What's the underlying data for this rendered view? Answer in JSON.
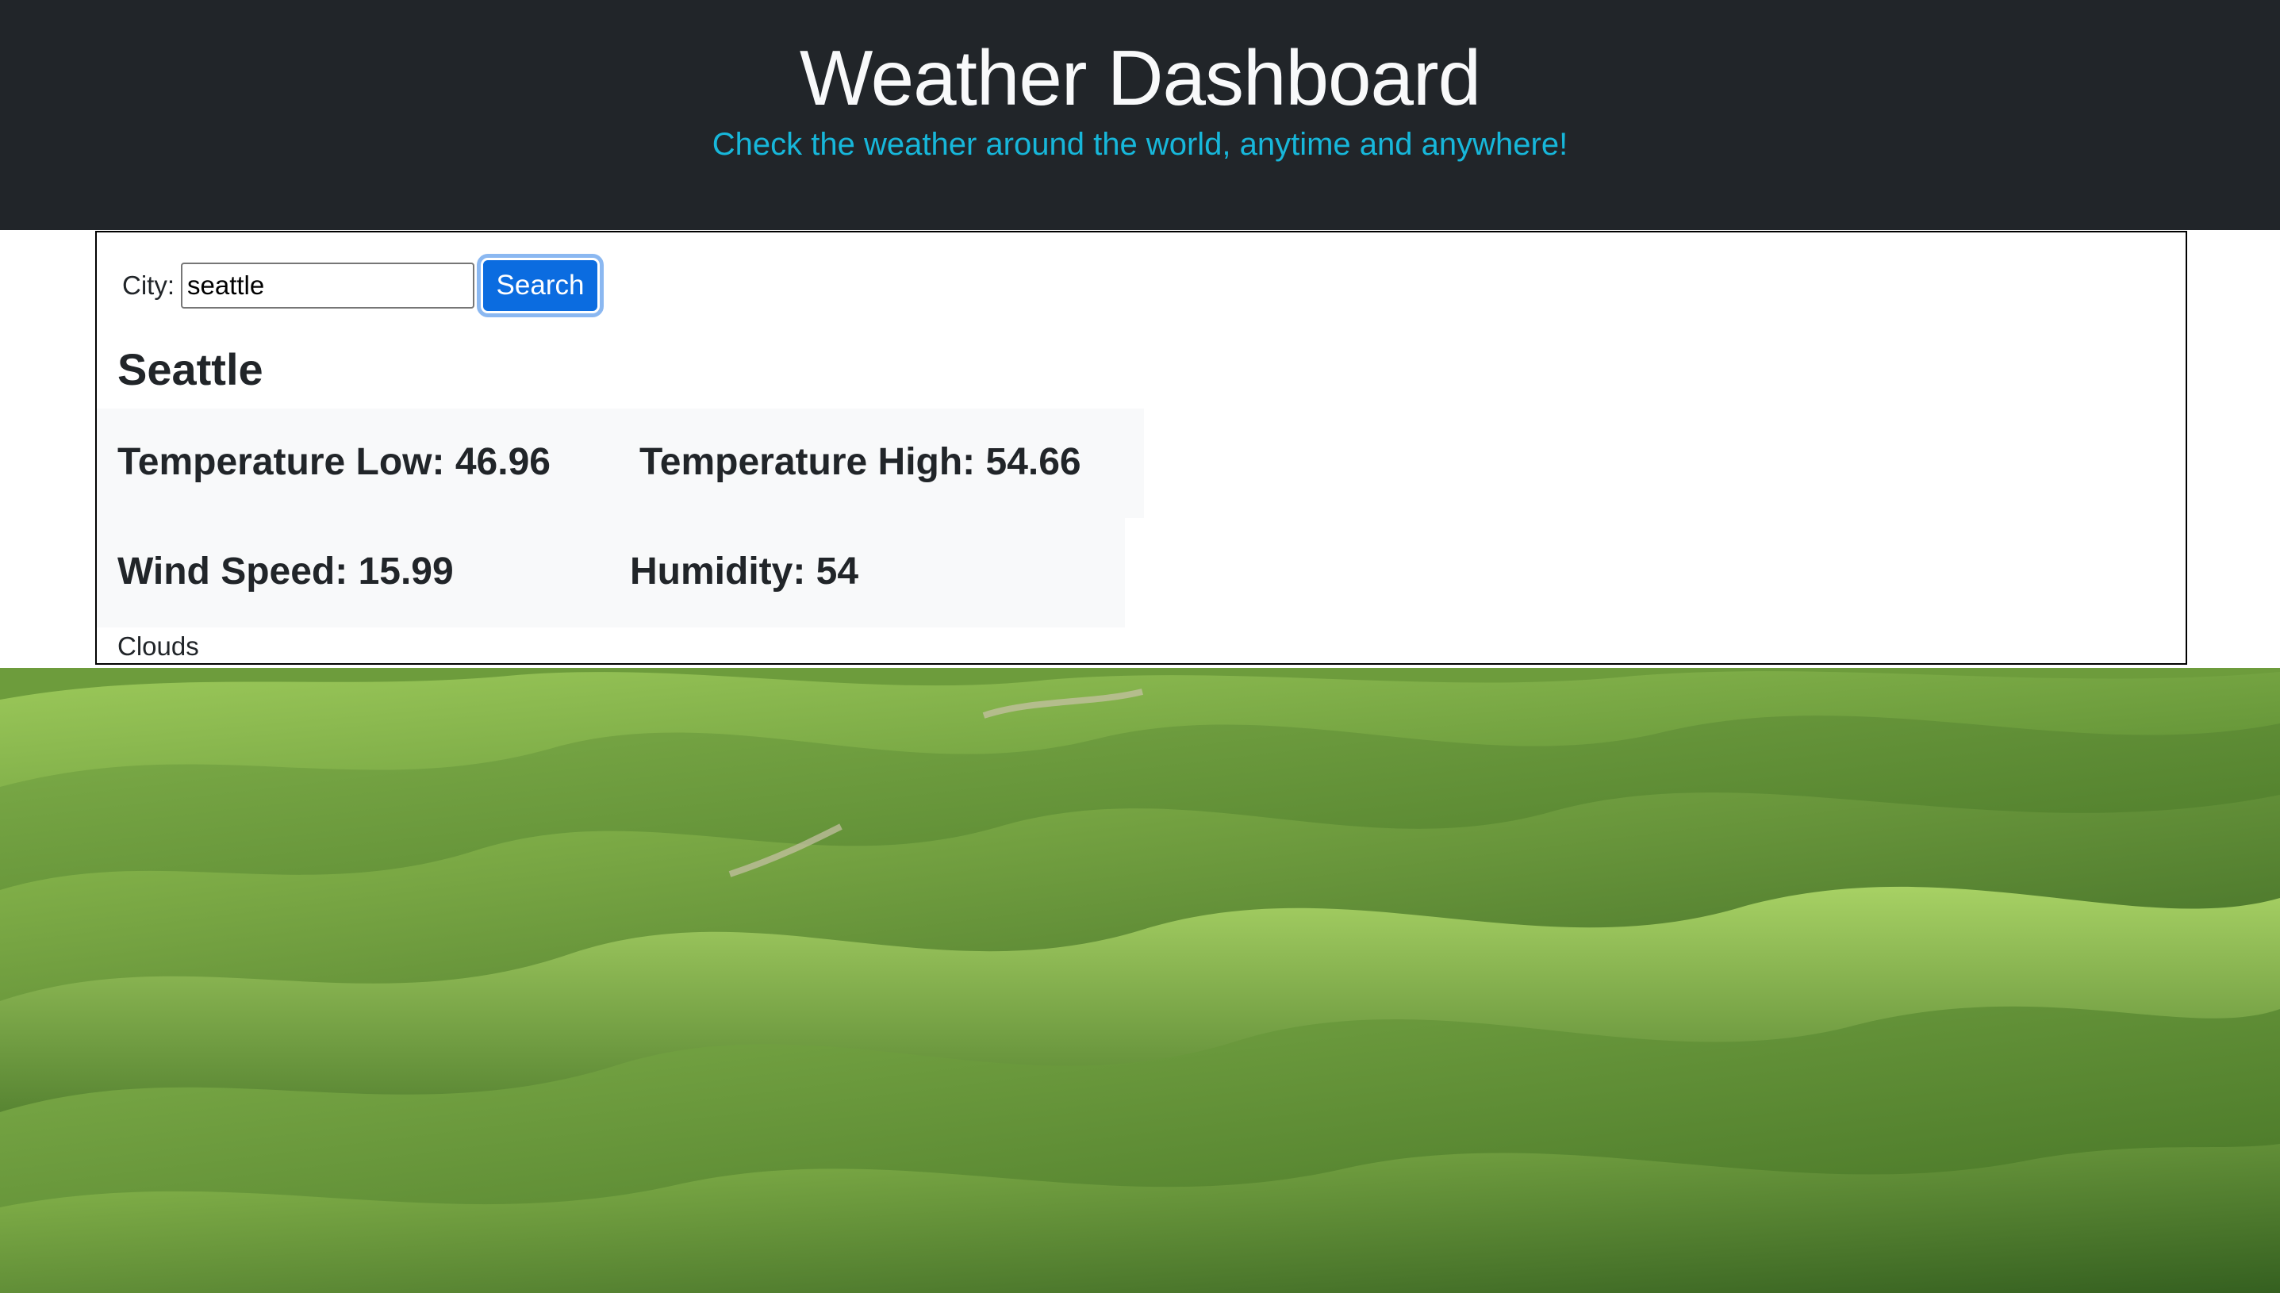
{
  "header": {
    "title": "Weather Dashboard",
    "subtitle": "Check the weather around the world, anytime and anywhere!"
  },
  "search": {
    "label": "City:",
    "value": "seattle",
    "button_label": "Search"
  },
  "weather": {
    "city": "Seattle",
    "temp_low": "Temperature Low: 46.96",
    "temp_high": "Temperature High: 54.66",
    "wind_speed": "Wind Speed: 15.99",
    "humidity": "Humidity: 54",
    "conditions": "Clouds"
  },
  "colors": {
    "header_bg": "#212529",
    "title": "#f8f9fa",
    "subtitle": "#17b7da",
    "button_bg": "#0b6ce0",
    "stats_bg": "#f8f9fa"
  },
  "background": {
    "icon": "green-hills-landscape"
  }
}
